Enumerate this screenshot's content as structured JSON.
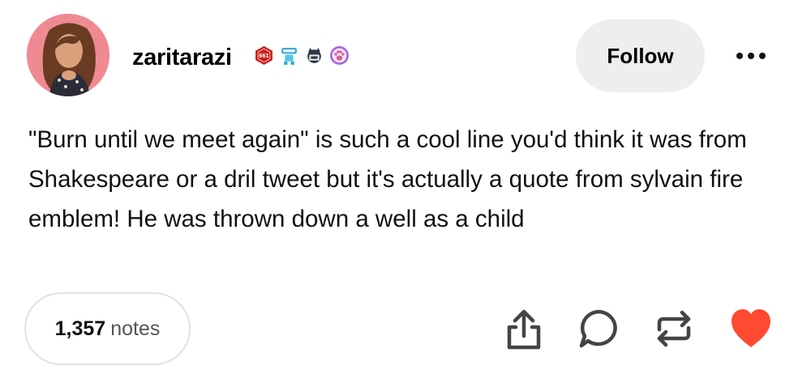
{
  "post": {
    "username": "zaritarazi",
    "badges": [
      {
        "icon": "red-hex-badge-icon",
        "text": "661",
        "color": "#c8201c"
      },
      {
        "icon": "blue-robot-badge-icon",
        "color": "#2aa7d8"
      },
      {
        "icon": "cat-computer-badge-icon",
        "color": "#2f3542"
      },
      {
        "icon": "purple-paw-badge-icon",
        "color": "#a566dd"
      }
    ],
    "follow_label": "Follow",
    "body": "\"Burn until we meet again\" is such a cool line you'd think it was from Shakespeare or a dril tweet but it's actually a quote from sylvain fire emblem! He was thrown down a well as a child",
    "notes_count": "1,357",
    "notes_label": "notes"
  },
  "actions": [
    {
      "icon": "share-icon"
    },
    {
      "icon": "reply-icon"
    },
    {
      "icon": "reblog-icon"
    },
    {
      "icon": "like-heart-icon",
      "color": "#ff4930"
    }
  ],
  "colors": {
    "avatar_bg": "#ef8a92",
    "button_bg": "#eeeeee",
    "heart": "#ff4930"
  }
}
